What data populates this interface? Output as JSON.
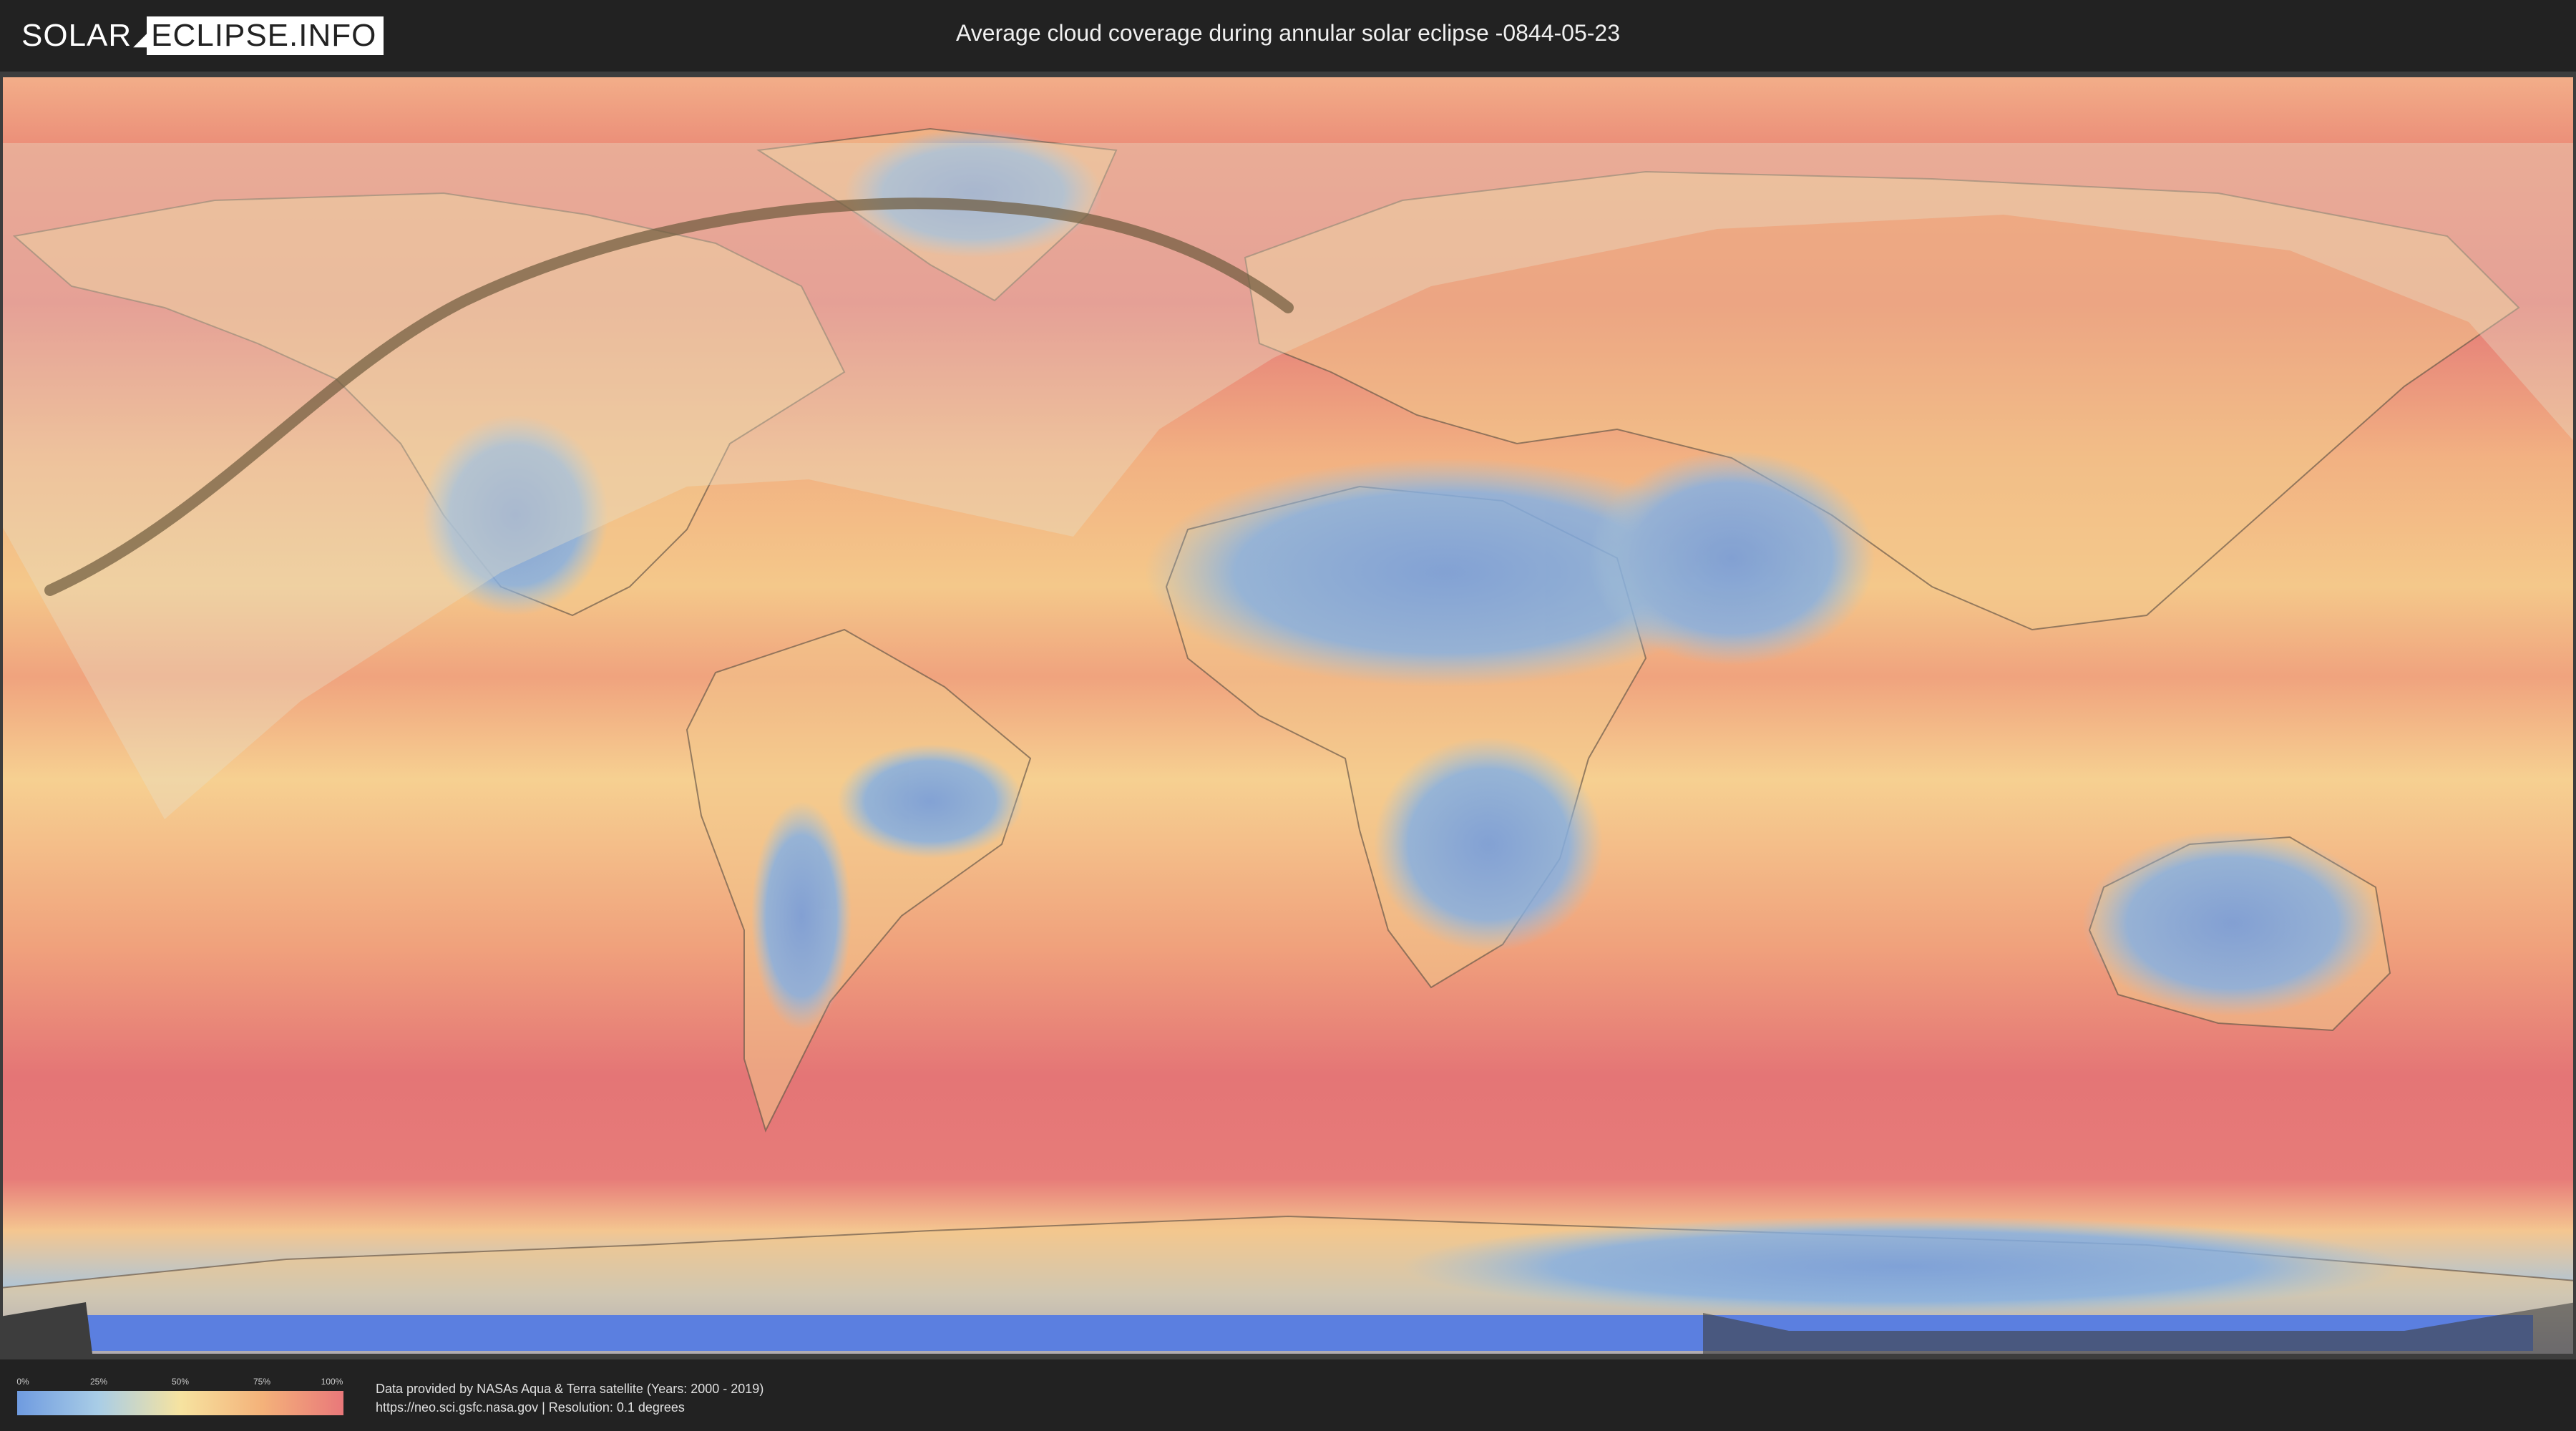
{
  "header": {
    "logo_left": "SOLAR",
    "logo_right": "ECLIPSE.INFO",
    "title": "Average cloud coverage during annular solar eclipse -0844-05-23"
  },
  "map": {
    "projection": "equirectangular world map",
    "layers": [
      "cloud-coverage",
      "country-borders",
      "eclipse-visibility-zone",
      "annular-path"
    ],
    "colors": {
      "clear": "#6f9be0",
      "low": "#a9cde6",
      "medium": "#f6e3a0",
      "high": "#f4b27a",
      "overcast": "#e9787a",
      "land_outline": "#6b5a4a",
      "path": "#6e5a3c",
      "frame": "#3d3d3d"
    }
  },
  "legend": {
    "ticks": [
      "0%",
      "25%",
      "50%",
      "75%",
      "100%"
    ],
    "gradient": [
      "#6f9be0",
      "#a9cde6",
      "#f6e3a0",
      "#f4b27a",
      "#e9787a"
    ]
  },
  "footer": {
    "credit_line1": "Data provided by NASAs Aqua & Terra satellite (Years: 2000 - 2019)",
    "credit_line2": "https://neo.sci.gsfc.nasa.gov | Resolution: 0.1 degrees"
  }
}
